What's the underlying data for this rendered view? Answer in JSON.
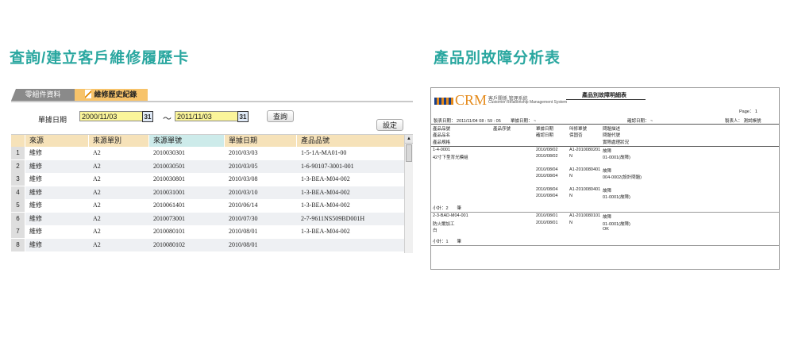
{
  "titles": {
    "left": "查詢/建立客戶維修履歷卡",
    "right": "產品別故障分析表"
  },
  "left_panel": {
    "tabs": [
      "零組件資料",
      "維修歷史紀錄"
    ],
    "date_label": "單據日期",
    "date_from": "2000/11/03",
    "date_to": "2011/11/03",
    "tilde": "～",
    "calendar_icon_text": "31",
    "query_button": "查詢",
    "settings_button": "設定",
    "columns": [
      "來源",
      "來源單別",
      "來源單號",
      "單據日期",
      "產品品號"
    ],
    "rows": [
      {
        "n": "1",
        "c": [
          "維修",
          "A2",
          "2010030301",
          "2010/03/03",
          "1-5-1A-MA01-00"
        ]
      },
      {
        "n": "2",
        "c": [
          "維修",
          "A2",
          "2010030501",
          "2010/03/05",
          "1-6-90107-3001-001"
        ]
      },
      {
        "n": "3",
        "c": [
          "維修",
          "A2",
          "2010030801",
          "2010/03/08",
          "1-3-BEA-M04-002"
        ]
      },
      {
        "n": "4",
        "c": [
          "維修",
          "A2",
          "2010031001",
          "2010/03/10",
          "1-3-BEA-M04-002"
        ]
      },
      {
        "n": "5",
        "c": [
          "維修",
          "A2",
          "2010061401",
          "2010/06/14",
          "1-3-BEA-M04-002"
        ]
      },
      {
        "n": "6",
        "c": [
          "維修",
          "A2",
          "2010073001",
          "2010/07/30",
          "2-7-9611NS509BD001H"
        ]
      },
      {
        "n": "7",
        "c": [
          "維修",
          "A2",
          "2010080101",
          "2010/08/01",
          "1-3-BEA-M04-002"
        ]
      },
      {
        "n": "8",
        "c": [
          "維修",
          "A2",
          "2010080102",
          "2010/08/01",
          ""
        ]
      }
    ],
    "colors": {
      "header_row": "#f6e2b9",
      "header_highlight": "#cdebea",
      "stripe": "#eef0f3"
    }
  },
  "report": {
    "logo": {
      "main": "CRM",
      "sub1": "客戶關係 管理系統",
      "sub2": "Customer Relationship Management System"
    },
    "title": "產品別故障明細表",
    "page": "Page： 1",
    "meta": {
      "made_date": "製表日期： 2011/11/04 08 : 59 : 05",
      "bill_date": "單據日期： ~",
      "confirm_date": "確認日期： ~",
      "maker": "製表人： 測試帳號"
    },
    "header": [
      [
        "產品品號",
        "產品序號",
        "單據日期",
        "叫修單號",
        "問題描述"
      ],
      [
        "產品品名",
        "",
        "確認日期",
        "保固否",
        "問題代號"
      ],
      [
        "產品規格",
        "",
        "",
        "",
        "實際處理狀況"
      ]
    ],
    "groups": [
      {
        "lines": [
          [
            "1-4-0001",
            "",
            "2010/08/02",
            "A1-2010080201",
            "故障"
          ],
          [
            "42寸下型背光模組",
            "",
            "2010/08/02",
            "N",
            "01-0001(故障)"
          ],
          [
            "",
            "",
            "",
            "",
            ""
          ],
          [
            "",
            "",
            "2010/08/04",
            "A1-2010080401",
            "故障"
          ],
          [
            "",
            "",
            "2010/08/04",
            "N",
            "004-0002(設計問題)"
          ],
          [
            "",
            "",
            "",
            "",
            ""
          ],
          [
            "",
            "",
            "2010/08/04",
            "A1-2010080401",
            "故障"
          ],
          [
            "",
            "",
            "2010/08/04",
            "N",
            "01-0001(故障)"
          ]
        ],
        "subtotal": "小計：2　　筆"
      },
      {
        "lines": [
          [
            "2-3-BAD-M04-001",
            "",
            "2010/08/01",
            "A1-2010080101",
            "故障"
          ],
          [
            "防火爾加工",
            "",
            "2010/08/01",
            "N",
            "01-0001(故障)"
          ],
          [
            "白",
            "",
            "",
            "",
            "OK"
          ]
        ],
        "subtotal": "小計：1　　筆"
      }
    ]
  }
}
